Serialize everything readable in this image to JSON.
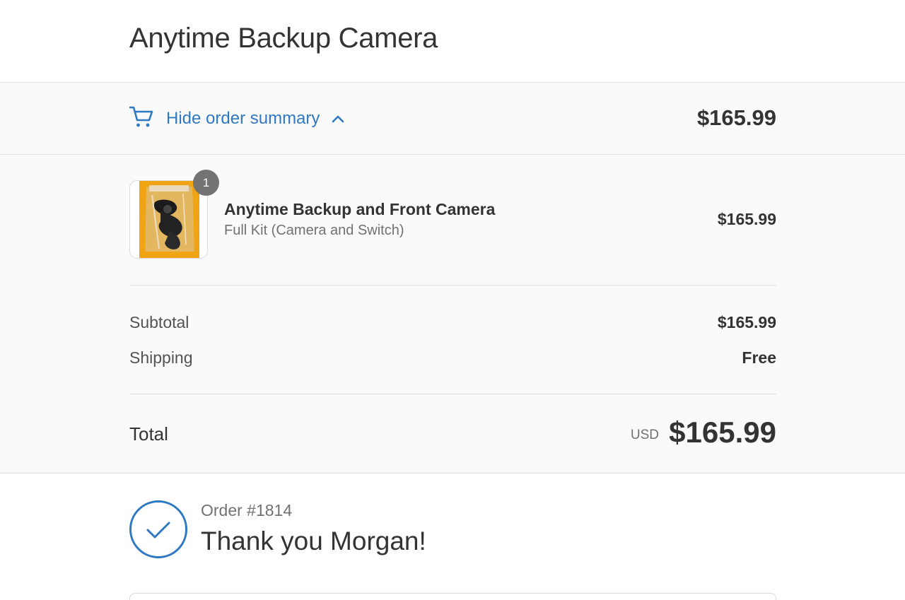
{
  "header": {
    "store_name": "Anytime Backup Camera"
  },
  "summary_toggle": {
    "icon": "cart-icon",
    "label": "Hide order summary",
    "chevron": "chevron-up-icon",
    "total": "$165.99"
  },
  "order_summary": {
    "items": [
      {
        "quantity": "1",
        "name": "Anytime Backup and Front Camera",
        "variant": "Full Kit (Camera and Switch)",
        "price": "$165.99"
      }
    ],
    "subtotal_label": "Subtotal",
    "subtotal_value": "$165.99",
    "shipping_label": "Shipping",
    "shipping_value": "Free",
    "total_label": "Total",
    "total_currency": "USD",
    "total_value": "$165.99"
  },
  "confirmation": {
    "icon": "checkmark-circle-icon",
    "order_number": "Order #1814",
    "heading": "Thank you Morgan!"
  },
  "colors": {
    "accent": "#2f79c2",
    "summary_background": "#fafafa",
    "badge": "#737373"
  }
}
